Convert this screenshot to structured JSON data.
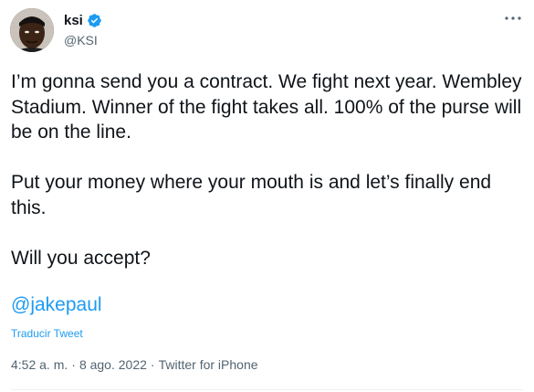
{
  "author": {
    "display_name": "ksi",
    "handle": "@KSI",
    "avatar_icon": "profile-avatar",
    "verified_icon": "verified-badge-icon",
    "verified_color": "#1d9bf0"
  },
  "menu": {
    "icon": "more-options-icon"
  },
  "tweet": {
    "paragraph_1": "I’m gonna send you a contract. We fight next year. Wembley Stadium. Winner of the fight takes all. 100% of the purse will be on the line.",
    "paragraph_2": "Put your money where your mouth is and let’s finally end this.",
    "paragraph_3": "Will you accept?",
    "mention": "@jakepaul",
    "translate_label": "Traducir Tweet"
  },
  "meta": {
    "time": "4:52 a. m.",
    "separator": "·",
    "date": "8 ago. 2022",
    "source": "Twitter for iPhone"
  },
  "colors": {
    "text": "#0f1419",
    "secondary": "#536471",
    "link": "#1d9bf0"
  }
}
